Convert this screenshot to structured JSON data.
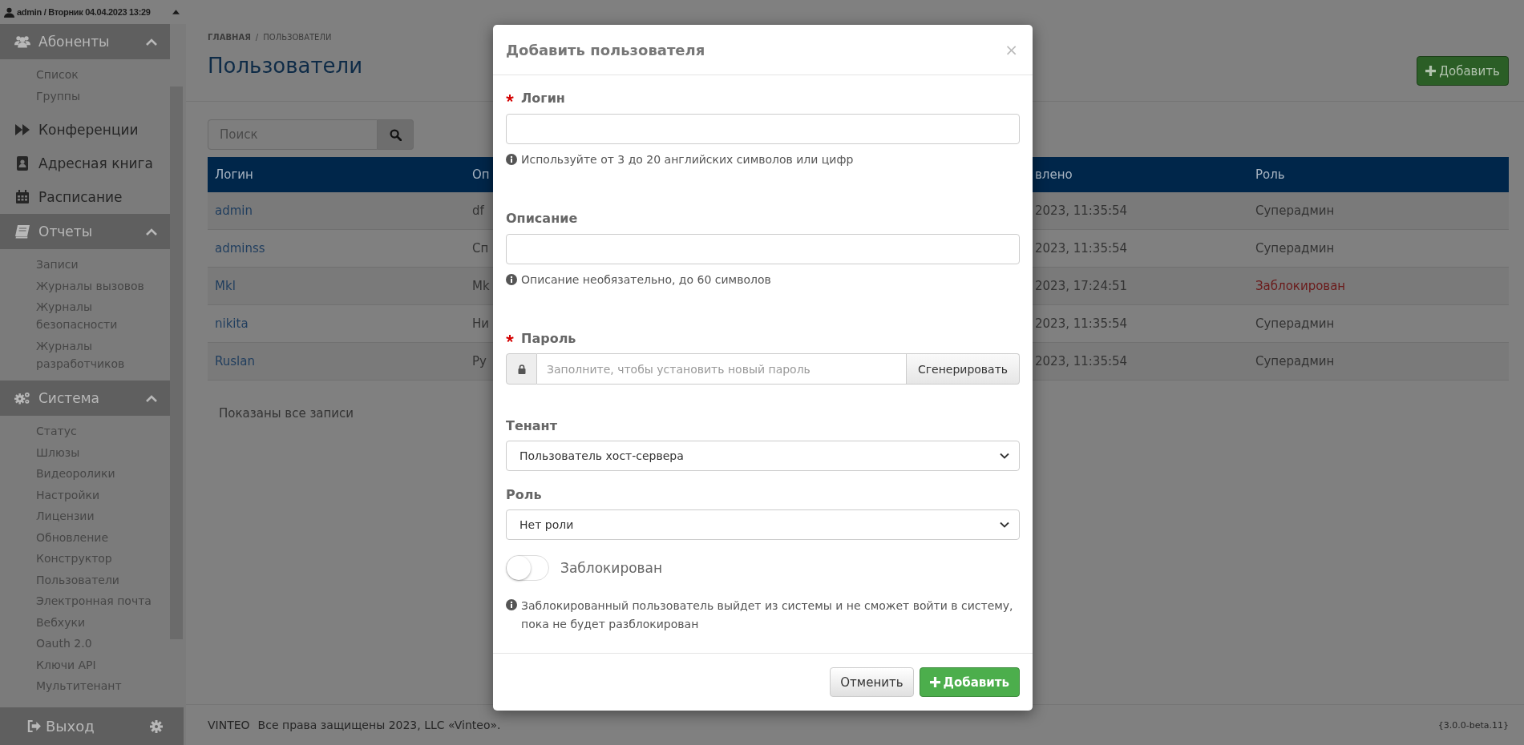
{
  "sidebar": {
    "user": "admin / Вторник 04.04.2023 13:29",
    "sections": [
      {
        "kind": "group",
        "label": "Абоненты",
        "expanded": true,
        "items": [
          "Список",
          "Группы"
        ]
      },
      {
        "kind": "link",
        "label": "Конференции"
      },
      {
        "kind": "link",
        "label": "Адресная книга"
      },
      {
        "kind": "link",
        "label": "Расписание"
      },
      {
        "kind": "group",
        "label": "Отчеты",
        "expanded": true,
        "items": [
          "Записи",
          "Журналы вызовов",
          "Журналы безопасности",
          "Журналы разработчиков"
        ]
      },
      {
        "kind": "group",
        "label": "Система",
        "expanded": true,
        "items": [
          "Статус",
          "Шлюзы",
          "Видеоролики",
          "Настройки",
          "Лицензии",
          "Обновление",
          "Конструктор",
          "Пользователи",
          "Электронная почта",
          "Вебхуки",
          "Oauth 2.0",
          "Ключи API",
          "Мультитенант"
        ]
      }
    ],
    "logout": "Выход"
  },
  "main": {
    "breadcrumb": {
      "items": [
        "ГЛАВНАЯ",
        "ПОЛЬЗОВАТЕЛИ"
      ],
      "separator": "/"
    },
    "title": "Пользователи",
    "add_button": "Добавить",
    "search": {
      "placeholder": "Поиск"
    },
    "table": {
      "columns": [
        "Логин",
        "Оп",
        "влено",
        "Роль"
      ],
      "rows": [
        {
          "cells": [
            "admin",
            "df",
            "2023, 11:35:54",
            "Суперадмин"
          ],
          "blocked": false
        },
        {
          "cells": [
            "adminss",
            "Сп",
            "2023, 11:35:54",
            "Суперадмин"
          ],
          "blocked": false
        },
        {
          "cells": [
            "Mkl",
            "Mk",
            "2023, 17:24:51",
            "Заблокирован"
          ],
          "blocked": true
        },
        {
          "cells": [
            "nikita",
            "Ни",
            "2023, 11:35:54",
            "Суперадмин"
          ],
          "blocked": false
        },
        {
          "cells": [
            "Ruslan",
            "Ру",
            "2023, 11:35:54",
            "Суперадмин"
          ],
          "blocked": false
        }
      ]
    },
    "summary": "Показаны все записи",
    "footer": {
      "brand": "VINTEO",
      "copyright": "Все права защищены 2023, LLC «Vinteo».",
      "version": "{3.0.0-beta.11}"
    }
  },
  "modal": {
    "title": "Добавить пользователя",
    "close": "×",
    "fields": [
      {
        "kind": "text",
        "label": "Логин",
        "required": true,
        "hint": "Используйте от 3 до 20 английских символов или цифр"
      },
      {
        "kind": "text",
        "label": "Описание",
        "required": false,
        "hint": "Описание необязательно, до 60 символов"
      },
      {
        "kind": "password",
        "label": "Пароль",
        "required": true,
        "placeholder": "Заполните, чтобы установить новый пароль",
        "button": "Сгенерировать"
      },
      {
        "kind": "select",
        "label": "Тенант",
        "required": false,
        "value": "Пользователь хост-сервера"
      },
      {
        "kind": "select",
        "label": "Роль",
        "required": false,
        "value": "Нет роли"
      },
      {
        "kind": "toggle",
        "label": "Заблокирован",
        "on": false,
        "hint": "Заблокированный пользователь выйдет из системы и не сможет войти в систему, пока не будет разблокирован"
      }
    ],
    "buttons": [
      {
        "kind": "cancel",
        "label": "Отменить"
      },
      {
        "kind": "primary",
        "label": "Добавить"
      }
    ]
  }
}
